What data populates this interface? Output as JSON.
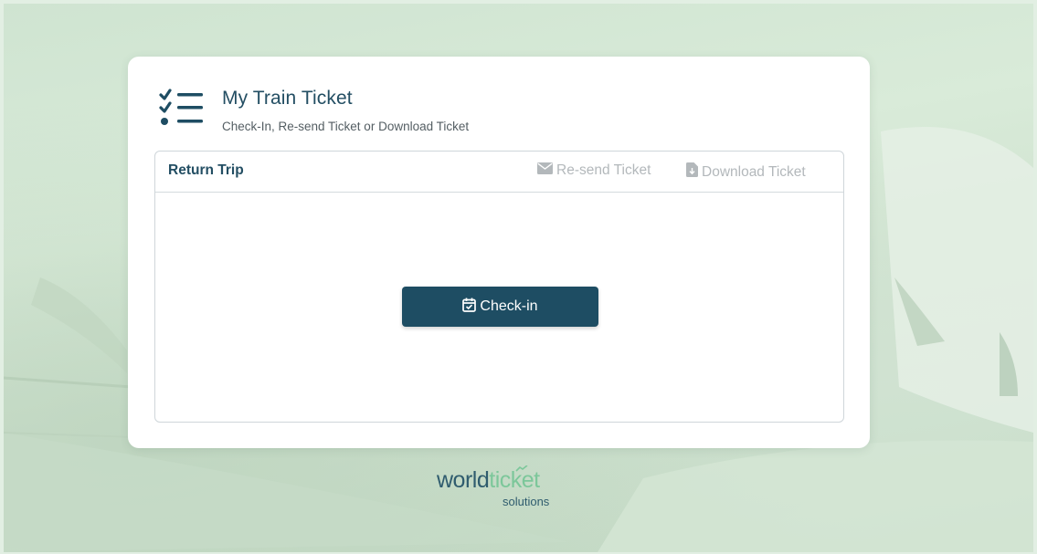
{
  "header": {
    "title": "My Train Ticket",
    "subtitle": "Check-In, Re-send Ticket or Download Ticket",
    "icon": "checklist-icon"
  },
  "trip": {
    "label": "Return Trip",
    "resend_label": "Re-send Ticket",
    "resend_icon": "envelope-icon",
    "download_label": "Download Ticket",
    "download_icon": "file-download-icon",
    "checkin_label": "Check-in",
    "checkin_icon": "calendar-check-icon"
  },
  "branding": {
    "logo_main": "world",
    "logo_accent": "ticket",
    "logo_sub": "solutions"
  },
  "colors": {
    "primary": "#1e4d63",
    "accent_green": "#7cc79a",
    "muted_action": "#b3b8bb",
    "background": "#d9ebd9"
  }
}
